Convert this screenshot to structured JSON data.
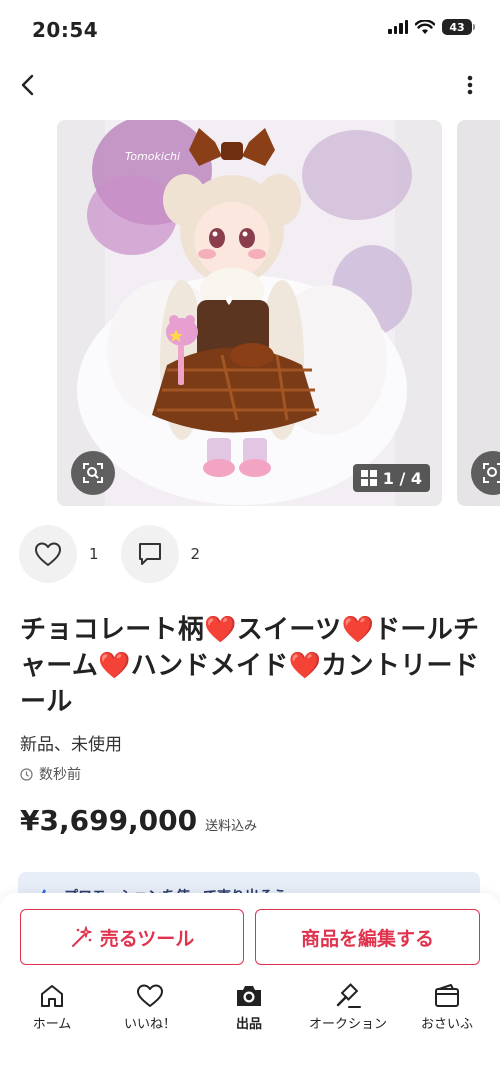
{
  "status_bar": {
    "time": "20:54",
    "battery": "43"
  },
  "item": {
    "watermark": "Tomokichi",
    "image_counter": "1 / 4",
    "likes": "1",
    "comments": "2",
    "title": "チョコレート柄❤️スイーツ❤️ドールチャーム❤️ハンドメイド❤️カントリードール",
    "condition": "新品、未使用",
    "posted": "数秒前",
    "price": "¥3,699,000",
    "shipping": "送料込み"
  },
  "promo": {
    "text": "プロモーションを使って売り出そう"
  },
  "actions": {
    "sell_tool": "売るツール",
    "edit_item": "商品を編集する"
  },
  "tabs": [
    {
      "label": "ホーム",
      "icon": "home-icon"
    },
    {
      "label": "いいね！",
      "icon": "heart-icon"
    },
    {
      "label": "出品",
      "icon": "camera-icon"
    },
    {
      "label": "オークション",
      "icon": "gavel-icon"
    },
    {
      "label": "おさいふ",
      "icon": "wallet-icon"
    }
  ],
  "colors": {
    "accent": "#e0334e",
    "chocolate": "#7a3b16",
    "promo_bg": "#e8eef8"
  }
}
